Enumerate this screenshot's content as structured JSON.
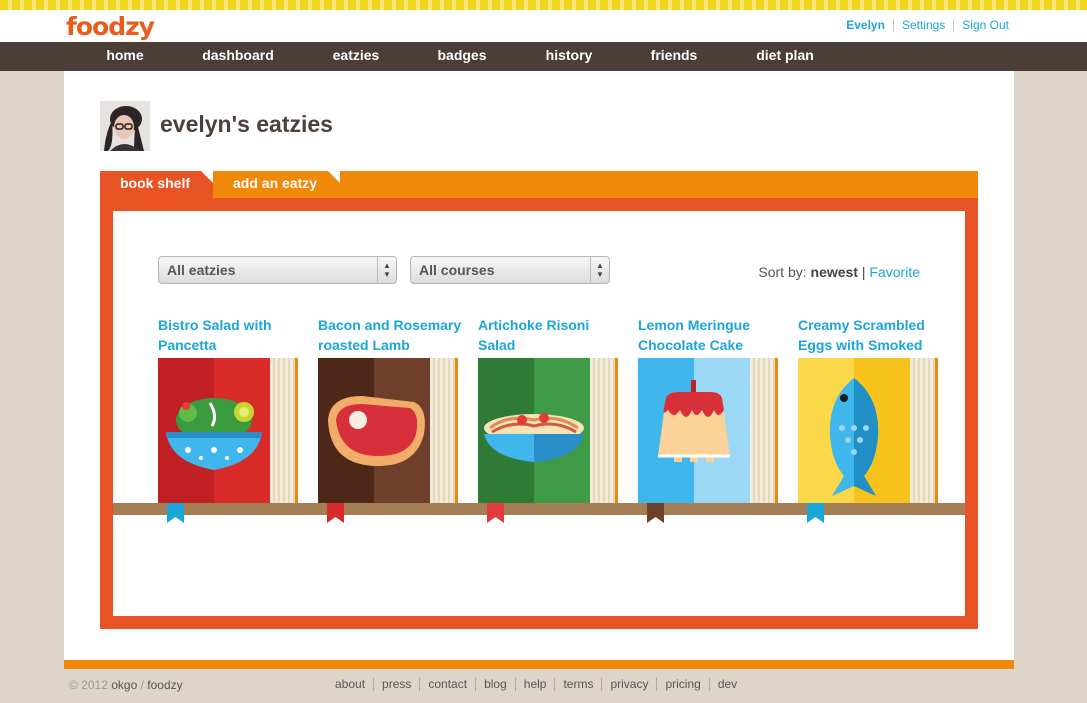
{
  "brand": {
    "logo": "foodzy"
  },
  "user_links": [
    "Evelyn",
    "Settings",
    "Sign Out"
  ],
  "nav": [
    {
      "label": "home"
    },
    {
      "label": "dashboard"
    },
    {
      "label": "eatzies",
      "active": true
    },
    {
      "label": "badges"
    },
    {
      "label": "history"
    },
    {
      "label": "friends"
    },
    {
      "label": "diet plan"
    }
  ],
  "page": {
    "title": "evelyn's eatzies"
  },
  "tabs": {
    "shelf": "book shelf",
    "add": "add an eatzy"
  },
  "filters": {
    "eatzies": "All eatzies",
    "courses": "All courses"
  },
  "sort": {
    "label": "Sort by:",
    "newest": "newest",
    "separator": "|",
    "favorite": "Favorite"
  },
  "books": [
    {
      "title": "Bistro Salad with Pancetta",
      "icon": "salad-bowl-icon",
      "color": "#d92b2a",
      "ribbon": "#1ba6d8"
    },
    {
      "title": "Bacon and Rosemary roasted Lamb",
      "icon": "steak-icon",
      "color": "#6e3f2a",
      "ribbon": "#d92b2a"
    },
    {
      "title": "Artichoke Risoni Salad",
      "icon": "pasta-bowl-icon",
      "color": "#3f9a45",
      "ribbon": "#d92b2a"
    },
    {
      "title": "Lemon Meringue Chocolate Cake",
      "icon": "cake-icon",
      "color": "#3fb6ec",
      "ribbon": "#6e3f2a"
    },
    {
      "title": "Creamy Scrambled Eggs with Smoked",
      "icon": "fish-icon",
      "color": "#f7c21b",
      "ribbon": "#1ba6d8"
    }
  ],
  "footer": {
    "copyright": "© 2012",
    "company": "okgo",
    "slash": "/",
    "brand": "foodzy",
    "links": [
      "about",
      "press",
      "contact",
      "blog",
      "help",
      "terms",
      "privacy",
      "pricing",
      "dev"
    ]
  }
}
